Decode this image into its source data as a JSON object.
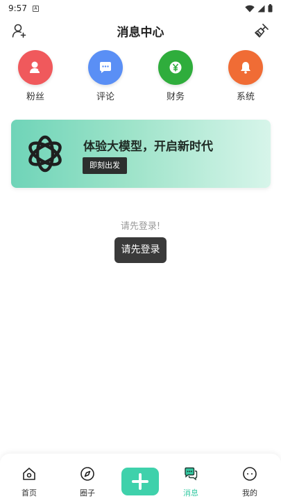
{
  "status_bar": {
    "time": "9:57",
    "notif_letter": "A"
  },
  "header": {
    "title": "消息中心"
  },
  "categories": [
    {
      "label": "粉丝",
      "color": "#f0595c",
      "icon": "user-plus-icon"
    },
    {
      "label": "评论",
      "color": "#5a8ff5",
      "icon": "comment-icon"
    },
    {
      "label": "财务",
      "color": "#2fad3c",
      "icon": "yuan-icon"
    },
    {
      "label": "系统",
      "color": "#f06c35",
      "icon": "bell-icon"
    }
  ],
  "banner": {
    "headline": "体验大模型，开启新时代",
    "cta": "即刻出发"
  },
  "login": {
    "hint": "请先登录!",
    "button": "请先登录"
  },
  "bottom_nav": {
    "home": "首页",
    "circle": "圈子",
    "messages": "消息",
    "mine": "我的",
    "accent": "#35c9a2"
  }
}
